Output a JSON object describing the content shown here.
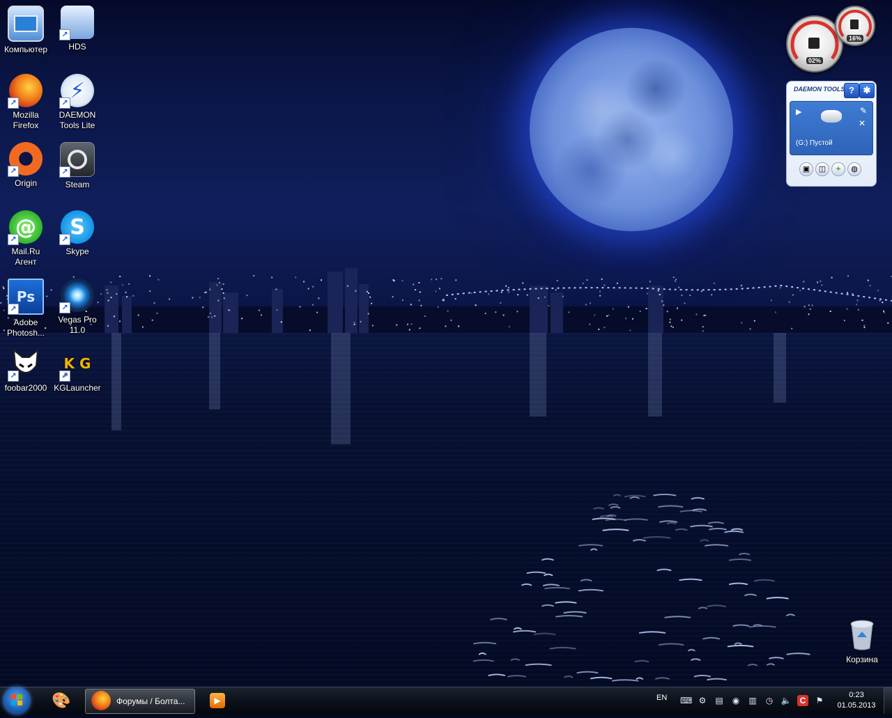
{
  "desktop_icons": [
    {
      "label": "Компьютер",
      "icon": "computer-icon"
    },
    {
      "label": "HDS",
      "icon": "network-computer-icon"
    },
    {
      "label": "Mozilla Firefox",
      "icon": "firefox-icon"
    },
    {
      "label": "DAEMON Tools Lite",
      "icon": "daemon-tools-icon"
    },
    {
      "label": "Origin",
      "icon": "origin-icon"
    },
    {
      "label": "Steam",
      "icon": "steam-icon"
    },
    {
      "label": "Mail.Ru Агент",
      "icon": "mailru-agent-icon"
    },
    {
      "label": "Skype",
      "icon": "skype-icon"
    },
    {
      "label": "Adobe Photosh...",
      "icon": "photoshop-icon",
      "glyph": "Ps"
    },
    {
      "label": "Vegas Pro 11.0",
      "icon": "vegas-pro-icon"
    },
    {
      "label": "foobar2000",
      "icon": "foobar-icon"
    },
    {
      "label": "KGLauncher",
      "icon": "kglauncher-icon",
      "glyph": "K G"
    },
    {
      "label": "Корзина",
      "icon": "recycle-bin-icon"
    }
  ],
  "gadgets": {
    "cpu_meter": {
      "cpu_percent": "02%",
      "memory_percent": "16%"
    },
    "daemon_tools": {
      "brand": "DAEMON TOOLS",
      "help": "?",
      "drive": "(G:) Пустой"
    }
  },
  "taskbar": {
    "open_window": "Форумы / Болта...",
    "language": "EN",
    "time": "0:23",
    "date": "01.05.2013"
  },
  "colors": {
    "sky": "#0a1545",
    "moon": "#8fb0ea",
    "taskbar": "#0c121b"
  }
}
